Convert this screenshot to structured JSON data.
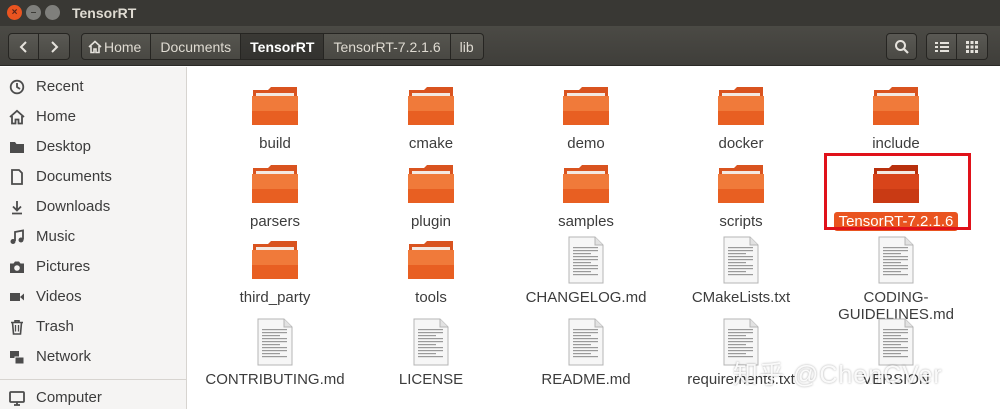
{
  "window": {
    "title": "TensorRT"
  },
  "colors": {
    "accent": "#e95420",
    "highlight_box": "#e0121a"
  },
  "toolbar": {
    "breadcrumbs": [
      {
        "label": "Home",
        "icon": "home-icon"
      },
      {
        "label": "Documents"
      },
      {
        "label": "TensorRT",
        "active": true
      },
      {
        "label": "TensorRT-7.2.1.6"
      },
      {
        "label": "lib"
      }
    ]
  },
  "sidebar": {
    "items": [
      {
        "label": "Recent",
        "icon": "clock-icon"
      },
      {
        "label": "Home",
        "icon": "home-icon"
      },
      {
        "label": "Desktop",
        "icon": "folder-icon"
      },
      {
        "label": "Documents",
        "icon": "document-icon"
      },
      {
        "label": "Downloads",
        "icon": "download-icon"
      },
      {
        "label": "Music",
        "icon": "music-icon"
      },
      {
        "label": "Pictures",
        "icon": "camera-icon"
      },
      {
        "label": "Videos",
        "icon": "video-icon"
      },
      {
        "label": "Trash",
        "icon": "trash-icon"
      },
      {
        "label": "Network",
        "icon": "network-icon"
      },
      {
        "label": "Computer",
        "icon": "computer-icon"
      }
    ]
  },
  "files": [
    {
      "name": "build",
      "type": "folder"
    },
    {
      "name": "cmake",
      "type": "folder"
    },
    {
      "name": "demo",
      "type": "folder"
    },
    {
      "name": "docker",
      "type": "folder"
    },
    {
      "name": "include",
      "type": "folder"
    },
    {
      "name": "parsers",
      "type": "folder"
    },
    {
      "name": "plugin",
      "type": "folder"
    },
    {
      "name": "samples",
      "type": "folder"
    },
    {
      "name": "scripts",
      "type": "folder"
    },
    {
      "name": "TensorRT-7.2.1.6",
      "type": "folder",
      "selected": true
    },
    {
      "name": "third_party",
      "type": "folder"
    },
    {
      "name": "tools",
      "type": "folder"
    },
    {
      "name": "CHANGELOG.md",
      "type": "text"
    },
    {
      "name": "CMakeLists.txt",
      "type": "text"
    },
    {
      "name": "CODING-GUIDELINES.md",
      "label_lines": [
        "CODING-",
        "GUIDELINES.md"
      ],
      "type": "text"
    },
    {
      "name": "CONTRIBUTING.md",
      "type": "text"
    },
    {
      "name": "LICENSE",
      "type": "text"
    },
    {
      "name": "README.md",
      "type": "text"
    },
    {
      "name": "requirements.txt",
      "type": "text"
    },
    {
      "name": "VERSION",
      "type": "text"
    }
  ],
  "watermark": "知乎 @ChenCVer"
}
